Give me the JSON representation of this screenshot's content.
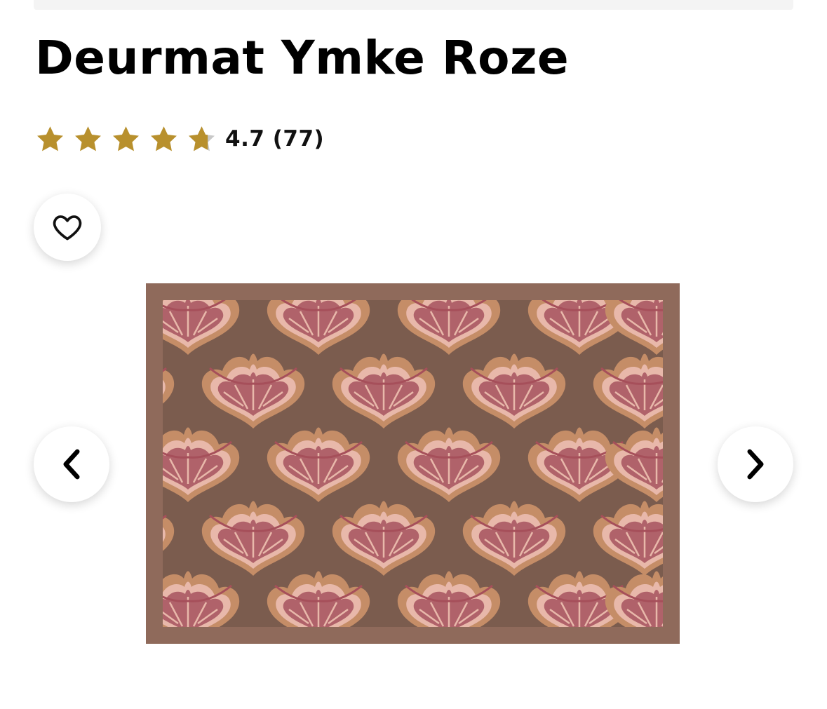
{
  "product": {
    "title": "Deurmat Ymke Roze",
    "rating": {
      "score": "4.7",
      "count": "(77)",
      "value": 4.7,
      "max": 5,
      "star_color": "#b8902d",
      "empty_star_color": "#c8c8c8"
    },
    "image": {
      "alt": "Deurmat Ymke Roze",
      "colors": {
        "border": "#8f6a5b",
        "field": "#7b5c4e",
        "fan_outer": "#c58d67",
        "fan_inner": "#b0626a",
        "fan_light": "#e8b8aa"
      }
    }
  },
  "controls": {
    "favorite_icon": "heart-icon",
    "prev_icon": "chevron-left-icon",
    "next_icon": "chevron-right-icon"
  }
}
